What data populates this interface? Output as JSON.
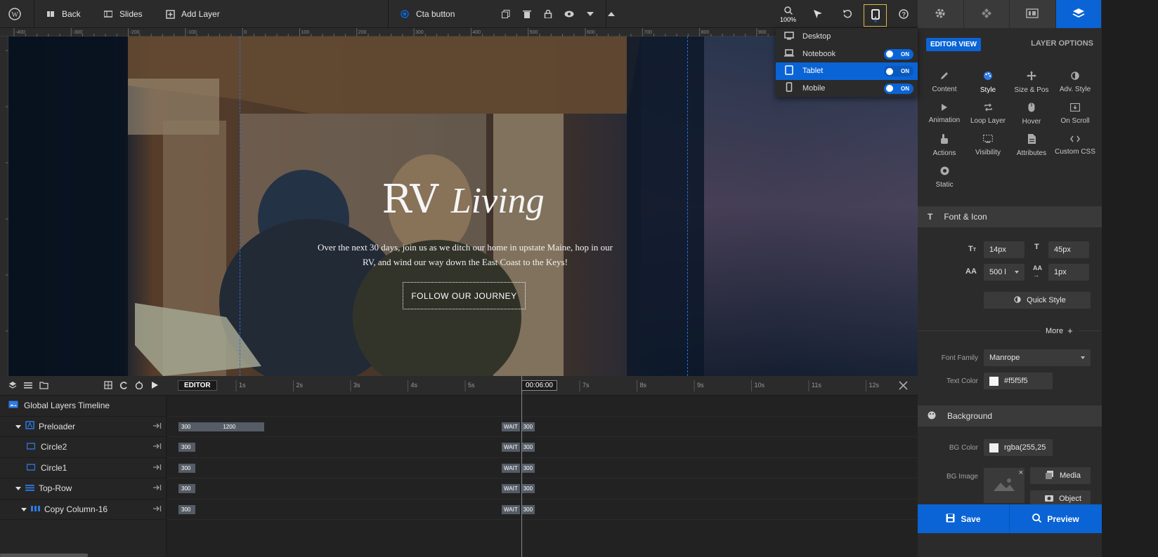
{
  "topbar": {
    "back_label": "Back",
    "slides_label": "Slides",
    "add_layer_label": "Add Layer",
    "layer_name": "Cta button",
    "zoom_label": "100%"
  },
  "ruler": {
    "marks": [
      "-400",
      "-300",
      "-200",
      "-100",
      "0",
      "100",
      "200",
      "300",
      "400",
      "500",
      "600",
      "700",
      "800",
      "900",
      "1000"
    ]
  },
  "device_menu": {
    "items": [
      {
        "label": "Desktop",
        "toggle": ""
      },
      {
        "label": "Notebook",
        "toggle": "ON"
      },
      {
        "label": "Tablet",
        "toggle": "ON"
      },
      {
        "label": "Mobile",
        "toggle": "ON"
      }
    ]
  },
  "slide": {
    "title_main": "RV",
    "title_script": "Living",
    "text_line1": "Over the next 30 days, join us as we ditch our home in upstate Maine, hop in our",
    "text_line2": "RV, and wind our way down the East Coast to the Keys!",
    "cta_label": "FOLLOW OUR JOURNEY"
  },
  "timeline": {
    "editor_label": "EDITOR",
    "seconds": [
      "1s",
      "2s",
      "3s",
      "4s",
      "5s",
      "00:06:00",
      "7s",
      "8s",
      "9s",
      "10s",
      "11s",
      "12s"
    ],
    "rows": [
      {
        "name": "Global Layers Timeline"
      },
      {
        "name": "Preloader",
        "bar1": "300",
        "bar2": "1200",
        "wait": "WAIT",
        "wait_val": "300"
      },
      {
        "name": "Circle2",
        "bar1": "300",
        "wait": "WAIT",
        "wait_val": "300"
      },
      {
        "name": "Circle1",
        "bar1": "300",
        "wait": "WAIT",
        "wait_val": "300"
      },
      {
        "name": "Top-Row",
        "bar1": "300",
        "wait": "WAIT",
        "wait_val": "300"
      },
      {
        "name": "Copy Column-16",
        "bar1": "300",
        "wait": "WAIT",
        "wait_val": "300"
      }
    ]
  },
  "panel": {
    "editor_view": "EDITOR VIEW",
    "layer_options": "LAYER OPTIONS",
    "options": [
      "Content",
      "Style",
      "Size & Pos",
      "Adv. Style",
      "Animation",
      "Loop Layer",
      "Hover",
      "On Scroll",
      "Actions",
      "Visibility",
      "Attributes",
      "Custom CSS",
      "Static"
    ],
    "font_section": "Font & Icon",
    "font_size": "14px",
    "line_height": "45px",
    "font_weight": "500 l",
    "letter_spacing": "1px",
    "quick_style": "Quick Style",
    "more": "More",
    "font_family_label": "Font Family",
    "font_family": "Manrope",
    "text_color_label": "Text Color",
    "text_color": "#f5f5f5",
    "bg_section": "Background",
    "bg_color_label": "BG Color",
    "bg_color": "rgba(255,25",
    "bg_image_label": "BG Image",
    "media": "Media",
    "object": "Object",
    "save": "Save",
    "preview": "Preview"
  },
  "colors": {
    "accent": "#0a64d6",
    "panel_bg": "#2b2b2b",
    "highlight_border": "#e0b84a"
  }
}
